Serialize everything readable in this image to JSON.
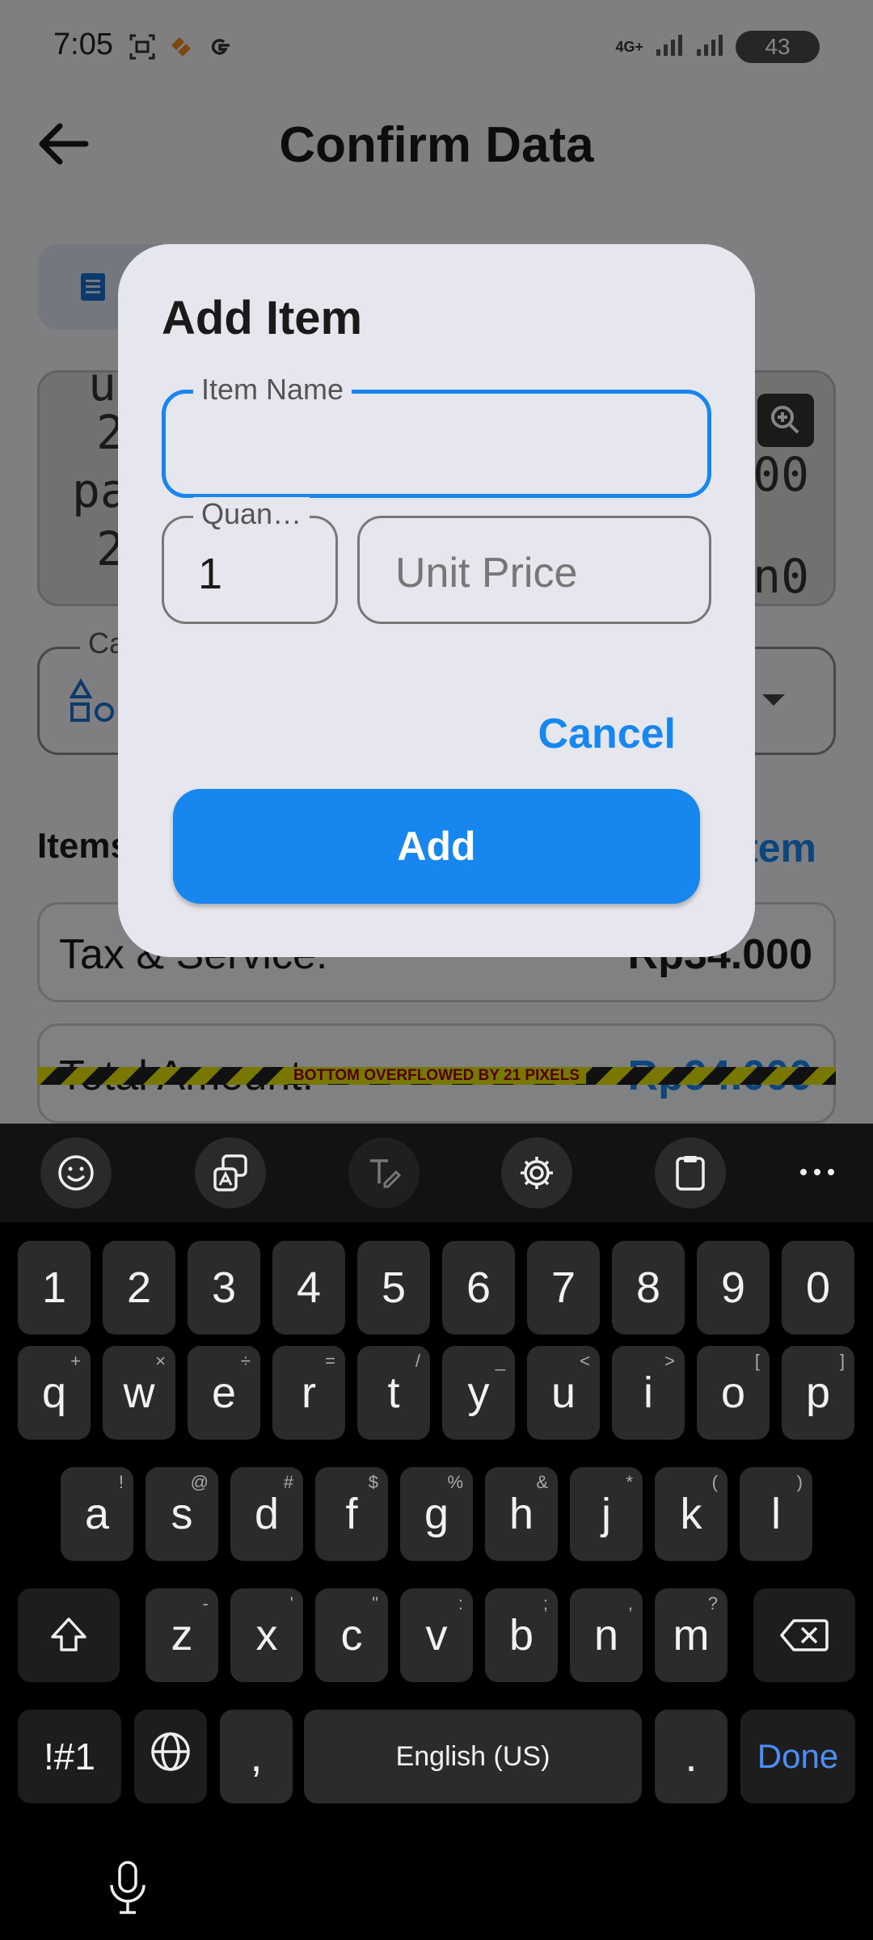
{
  "status_bar": {
    "time": "7:05",
    "network": "4G+",
    "battery": "43"
  },
  "app_bar": {
    "title": "Confirm Data"
  },
  "background": {
    "receipt_lines": [
      "2",
      "pa",
      "2",
      "00",
      "n0",
      "ut"
    ],
    "category_label": "Ca",
    "items_header": "Items",
    "add_item_link": "tem",
    "tax_label": "Tax & Service:",
    "tax_value": "Rp34.000",
    "total_label": "Total Amount:",
    "total_value": "Rp94.000",
    "overflow_warning": "BOTTOM OVERFLOWED BY 21 PIXELS"
  },
  "dialog": {
    "title": "Add Item",
    "item_name_label": "Item Name",
    "item_name_value": "",
    "quantity_label": "Quan…",
    "quantity_value": "1",
    "unit_price_placeholder": "Unit Price",
    "cancel_label": "Cancel",
    "add_label": "Add"
  },
  "keyboard": {
    "toolbar_icons": [
      "emoji-icon",
      "text-translate-icon",
      "handwriting-icon",
      "settings-gear-icon",
      "clipboard-icon",
      "more-dots-icon"
    ],
    "number_row": [
      "1",
      "2",
      "3",
      "4",
      "5",
      "6",
      "7",
      "8",
      "9",
      "0"
    ],
    "row1": [
      {
        "k": "q",
        "h": "+"
      },
      {
        "k": "w",
        "h": "×"
      },
      {
        "k": "e",
        "h": "÷"
      },
      {
        "k": "r",
        "h": "="
      },
      {
        "k": "t",
        "h": "/"
      },
      {
        "k": "y",
        "h": "_"
      },
      {
        "k": "u",
        "h": "<"
      },
      {
        "k": "i",
        "h": ">"
      },
      {
        "k": "o",
        "h": "["
      },
      {
        "k": "p",
        "h": "]"
      }
    ],
    "row2": [
      {
        "k": "a",
        "h": "!"
      },
      {
        "k": "s",
        "h": "@"
      },
      {
        "k": "d",
        "h": "#"
      },
      {
        "k": "f",
        "h": "$"
      },
      {
        "k": "g",
        "h": "%"
      },
      {
        "k": "h",
        "h": "&"
      },
      {
        "k": "j",
        "h": "*"
      },
      {
        "k": "k",
        "h": "("
      },
      {
        "k": "l",
        "h": ")"
      }
    ],
    "row3": [
      {
        "k": "z",
        "h": "-"
      },
      {
        "k": "x",
        "h": "'"
      },
      {
        "k": "c",
        "h": "\""
      },
      {
        "k": "v",
        "h": ":"
      },
      {
        "k": "b",
        "h": ";"
      },
      {
        "k": "n",
        "h": ","
      },
      {
        "k": "m",
        "h": "?"
      }
    ],
    "symbols_label": "!#1",
    "comma": ",",
    "space_label": "English (US)",
    "period": ".",
    "done_label": "Done"
  }
}
